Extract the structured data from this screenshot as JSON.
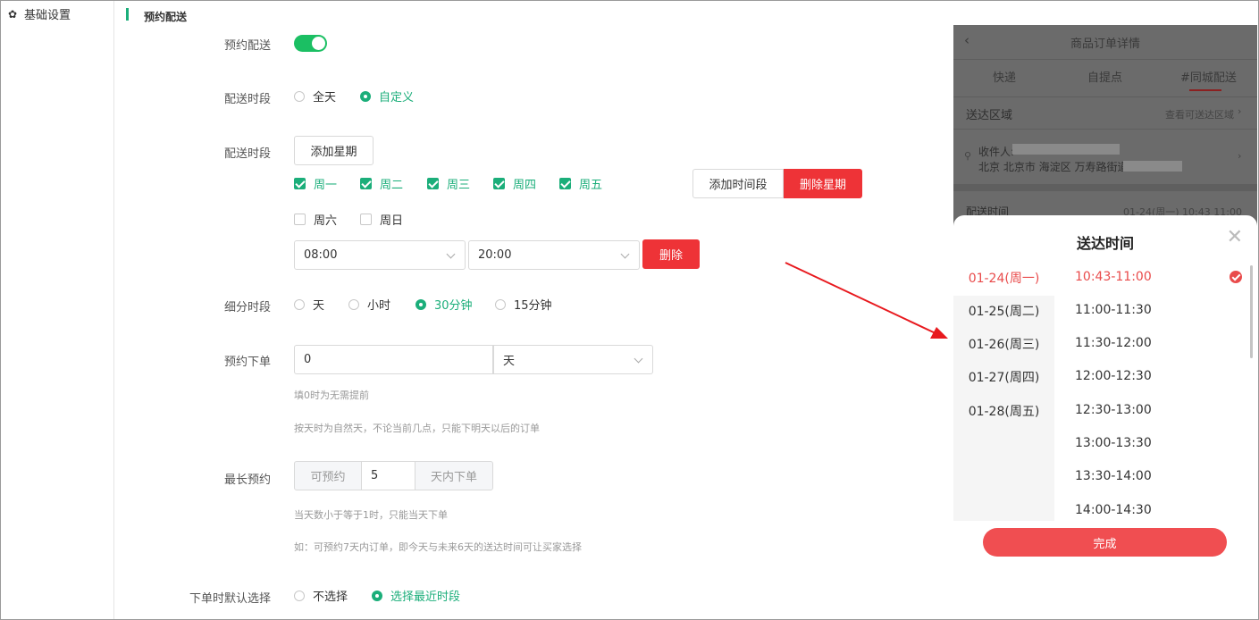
{
  "sidebar": {
    "item_label": "基础设置",
    "icon": "gear-icon"
  },
  "section": {
    "title": "预约配送"
  },
  "form": {
    "enable": {
      "label": "预约配送",
      "on": true
    },
    "time_mode": {
      "label": "配送时段",
      "options": [
        "全天",
        "自定义"
      ],
      "selected": "自定义"
    },
    "periods": {
      "label": "配送时段",
      "add_week_button": "添加星期",
      "days": [
        {
          "label": "周一",
          "checked": true
        },
        {
          "label": "周二",
          "checked": true
        },
        {
          "label": "周三",
          "checked": true
        },
        {
          "label": "周四",
          "checked": true
        },
        {
          "label": "周五",
          "checked": true
        },
        {
          "label": "周六",
          "checked": false
        },
        {
          "label": "周日",
          "checked": false
        }
      ],
      "add_time_button": "添加时间段",
      "delete_week_button": "删除星期",
      "start_time": "08:00",
      "end_time": "20:00",
      "delete_button": "删除"
    },
    "granularity": {
      "label": "细分时段",
      "options": [
        "天",
        "小时",
        "30分钟",
        "15分钟"
      ],
      "selected": "30分钟"
    },
    "advance": {
      "label": "预约下单",
      "value": "0",
      "unit": "天",
      "hint1": "填0时为无需提前",
      "hint2": "按天时为自然天，不论当前几点，只能下明天以后的订单"
    },
    "max_days": {
      "label": "最长预约",
      "prefix": "可预约",
      "value": "5",
      "suffix": "天内下单",
      "hint1": "当天数小于等于1时，只能当天下单",
      "hint2": "如：可预约7天内订单，即今天与未来6天的送达时间可让买家选择"
    },
    "default_choice": {
      "label": "下单时默认选择",
      "options": [
        "不选择",
        "选择最近时段"
      ],
      "selected": "选择最近时段"
    }
  },
  "phone": {
    "back_icon": "chevron-left-icon",
    "title": "商品订单详情",
    "tabs": [
      "快递",
      "自提点",
      "#同城配送"
    ],
    "active_tab": "#同城配送",
    "area_label": "送达区域",
    "area_link": "查看可送达区域",
    "receiver_label": "收件人:",
    "address": "北京 北京市 海淀区 万寿路街道",
    "delivery_time_label": "配送时间",
    "delivery_time_value": "01-24(周一) 10:43 11:00",
    "sheet": {
      "title": "送达时间",
      "close_icon": "close-icon",
      "dates": [
        "01-24(周一)",
        "01-25(周二)",
        "01-26(周三)",
        "01-27(周四)",
        "01-28(周五)"
      ],
      "selected_date": "01-24(周一)",
      "slots": [
        "10:43-11:00",
        "11:00-11:30",
        "11:30-12:00",
        "12:00-12:30",
        "12:30-13:00",
        "13:00-13:30",
        "13:30-14:00",
        "14:00-14:30"
      ],
      "selected_slot": "10:43-11:00",
      "done_button": "完成"
    }
  },
  "colors": {
    "accent": "#1bae7a",
    "danger": "#ee3337",
    "phone_accent": "#e94b4b",
    "arrow": "#e8191e"
  }
}
